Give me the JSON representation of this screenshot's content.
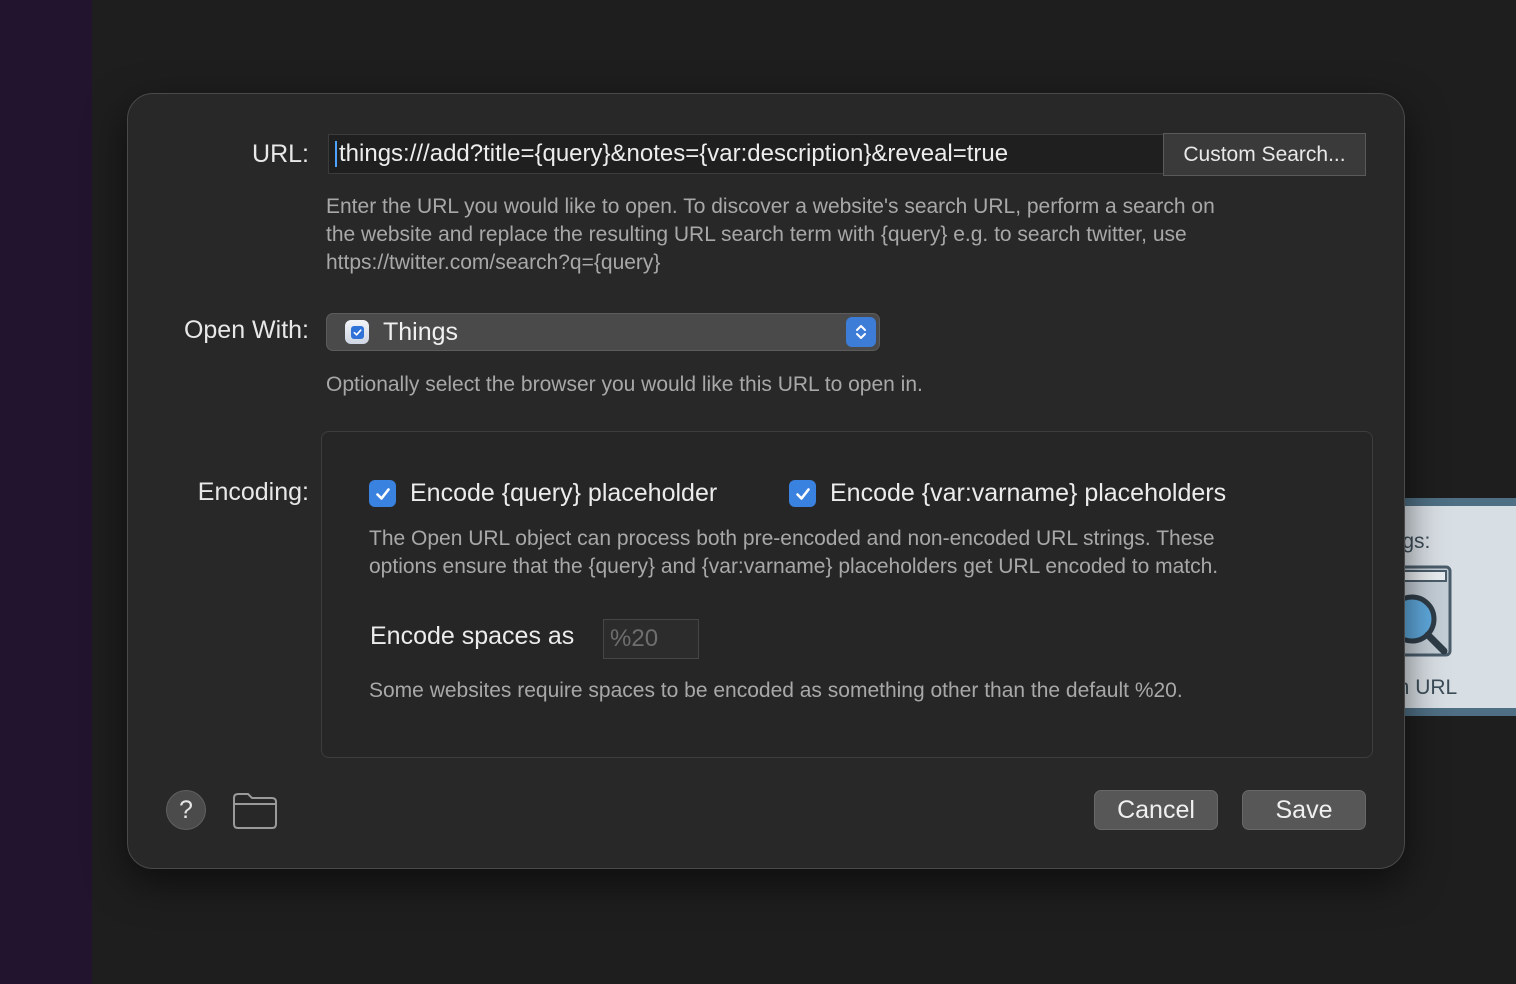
{
  "dialog": {
    "url": {
      "label": "URL:",
      "value": "things:///add?title={query}&notes={var:description}&reveal=true",
      "custom_search_label": "Custom Search...",
      "help_line1": "Enter the URL you would like to open. To discover a website's search URL, perform a search on",
      "help_line2": "the website and replace the resulting URL search term with {query} e.g. to search twitter, use",
      "help_line3": "https://twitter.com/search?q={query}"
    },
    "open_with": {
      "label": "Open With:",
      "selected": "Things",
      "app_icon": "things-app-icon",
      "help": "Optionally select the browser you would like this URL to open in."
    },
    "encoding": {
      "label": "Encoding:",
      "encode_query_label": "Encode {query} placeholder",
      "encode_query_checked": true,
      "encode_var_label": "Encode {var:varname} placeholders",
      "encode_var_checked": true,
      "help_line1": "The Open URL object can process both pre-encoded and non-encoded URL strings. These",
      "help_line2": "options ensure that the {query} and {var:varname} placeholders get URL encoded to match.",
      "spaces_label": "Encode spaces as",
      "spaces_placeholder": "%20",
      "spaces_help": "Some websites require spaces to be encoded as something other than the default %20."
    },
    "footer": {
      "help_icon": "question-icon",
      "help_glyph": "?",
      "folder_icon": "folder-icon",
      "cancel_label": "Cancel",
      "save_label": "Save"
    }
  },
  "background_node": {
    "title_fragment": "ings:",
    "label_fragment": "en URL",
    "icon": "magnifier-icon"
  },
  "colors": {
    "accent": "#3a82df",
    "dialog_bg": "#282828",
    "window_bg": "#1e1e1e",
    "sidebar_strip": "#22132e"
  }
}
